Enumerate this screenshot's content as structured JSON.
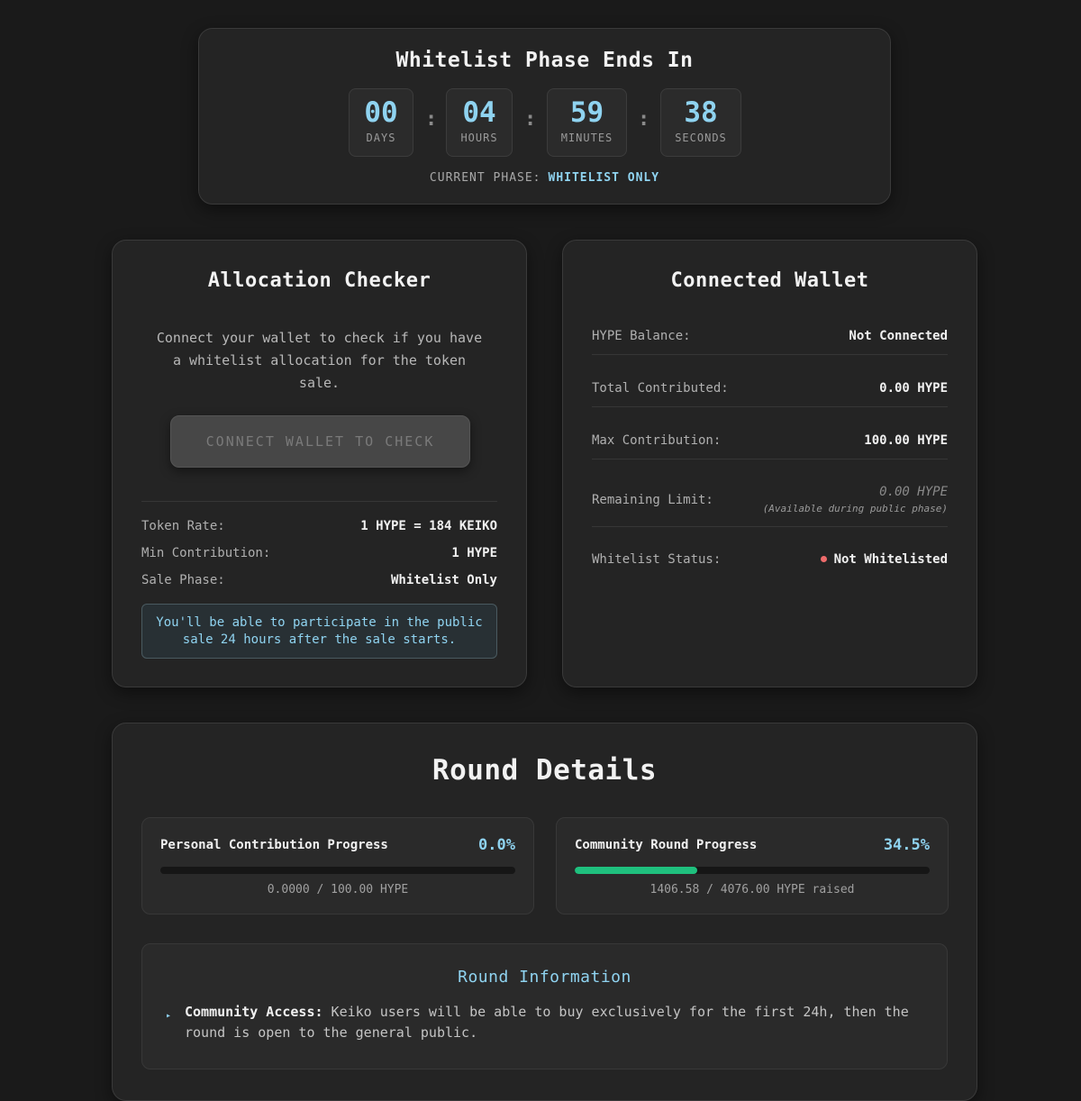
{
  "countdown": {
    "title": "Whitelist Phase Ends In",
    "units": [
      {
        "value": "00",
        "label": "DAYS"
      },
      {
        "value": "04",
        "label": "HOURS"
      },
      {
        "value": "59",
        "label": "MINUTES"
      },
      {
        "value": "38",
        "label": "SECONDS"
      }
    ],
    "separator": ":",
    "phase_label": "CURRENT PHASE:",
    "phase_value": "WHITELIST ONLY"
  },
  "allocation": {
    "title": "Allocation Checker",
    "description": "Connect your wallet to check if you have a whitelist allocation for the token sale.",
    "button_label": "CONNECT WALLET TO CHECK",
    "rows": [
      {
        "label": "Token Rate:",
        "value": "1 HYPE = 184 KEIKO"
      },
      {
        "label": "Min Contribution:",
        "value": "1 HYPE"
      },
      {
        "label": "Sale Phase:",
        "value": "Whitelist Only"
      }
    ],
    "notice": "You'll be able to participate in the public sale 24 hours after the sale starts."
  },
  "wallet": {
    "title": "Connected Wallet",
    "rows": [
      {
        "label": "HYPE Balance:",
        "value": "Not Connected"
      },
      {
        "label": "Total Contributed:",
        "value": "0.00 HYPE"
      },
      {
        "label": "Max Contribution:",
        "value": "100.00 HYPE"
      },
      {
        "label": "Remaining Limit:",
        "value": "0.00 HYPE",
        "note": "(Available during public phase)"
      },
      {
        "label": "Whitelist Status:",
        "value": "Not Whitelisted"
      }
    ],
    "status_color": "#ee6b6b"
  },
  "round": {
    "title": "Round Details",
    "personal": {
      "title": "Personal Contribution Progress",
      "percent_text": "0.0%",
      "progress": 0.0,
      "amount": "0.0000 / 100.00 HYPE"
    },
    "community": {
      "title": "Community Round Progress",
      "percent_text": "34.5%",
      "progress": 34.5,
      "amount": "1406.58 / 4076.00 HYPE raised"
    },
    "info": {
      "title": "Round Information",
      "bullet": "▸",
      "item_label": "Community Access:",
      "item_text": " Keiko users will be able to buy exclusively for the first 24h, then the round is open to the general public."
    }
  },
  "colors": {
    "accent": "#8fd3f0",
    "progress_fill": "#1fc07e",
    "background": "#1a1a1a"
  }
}
